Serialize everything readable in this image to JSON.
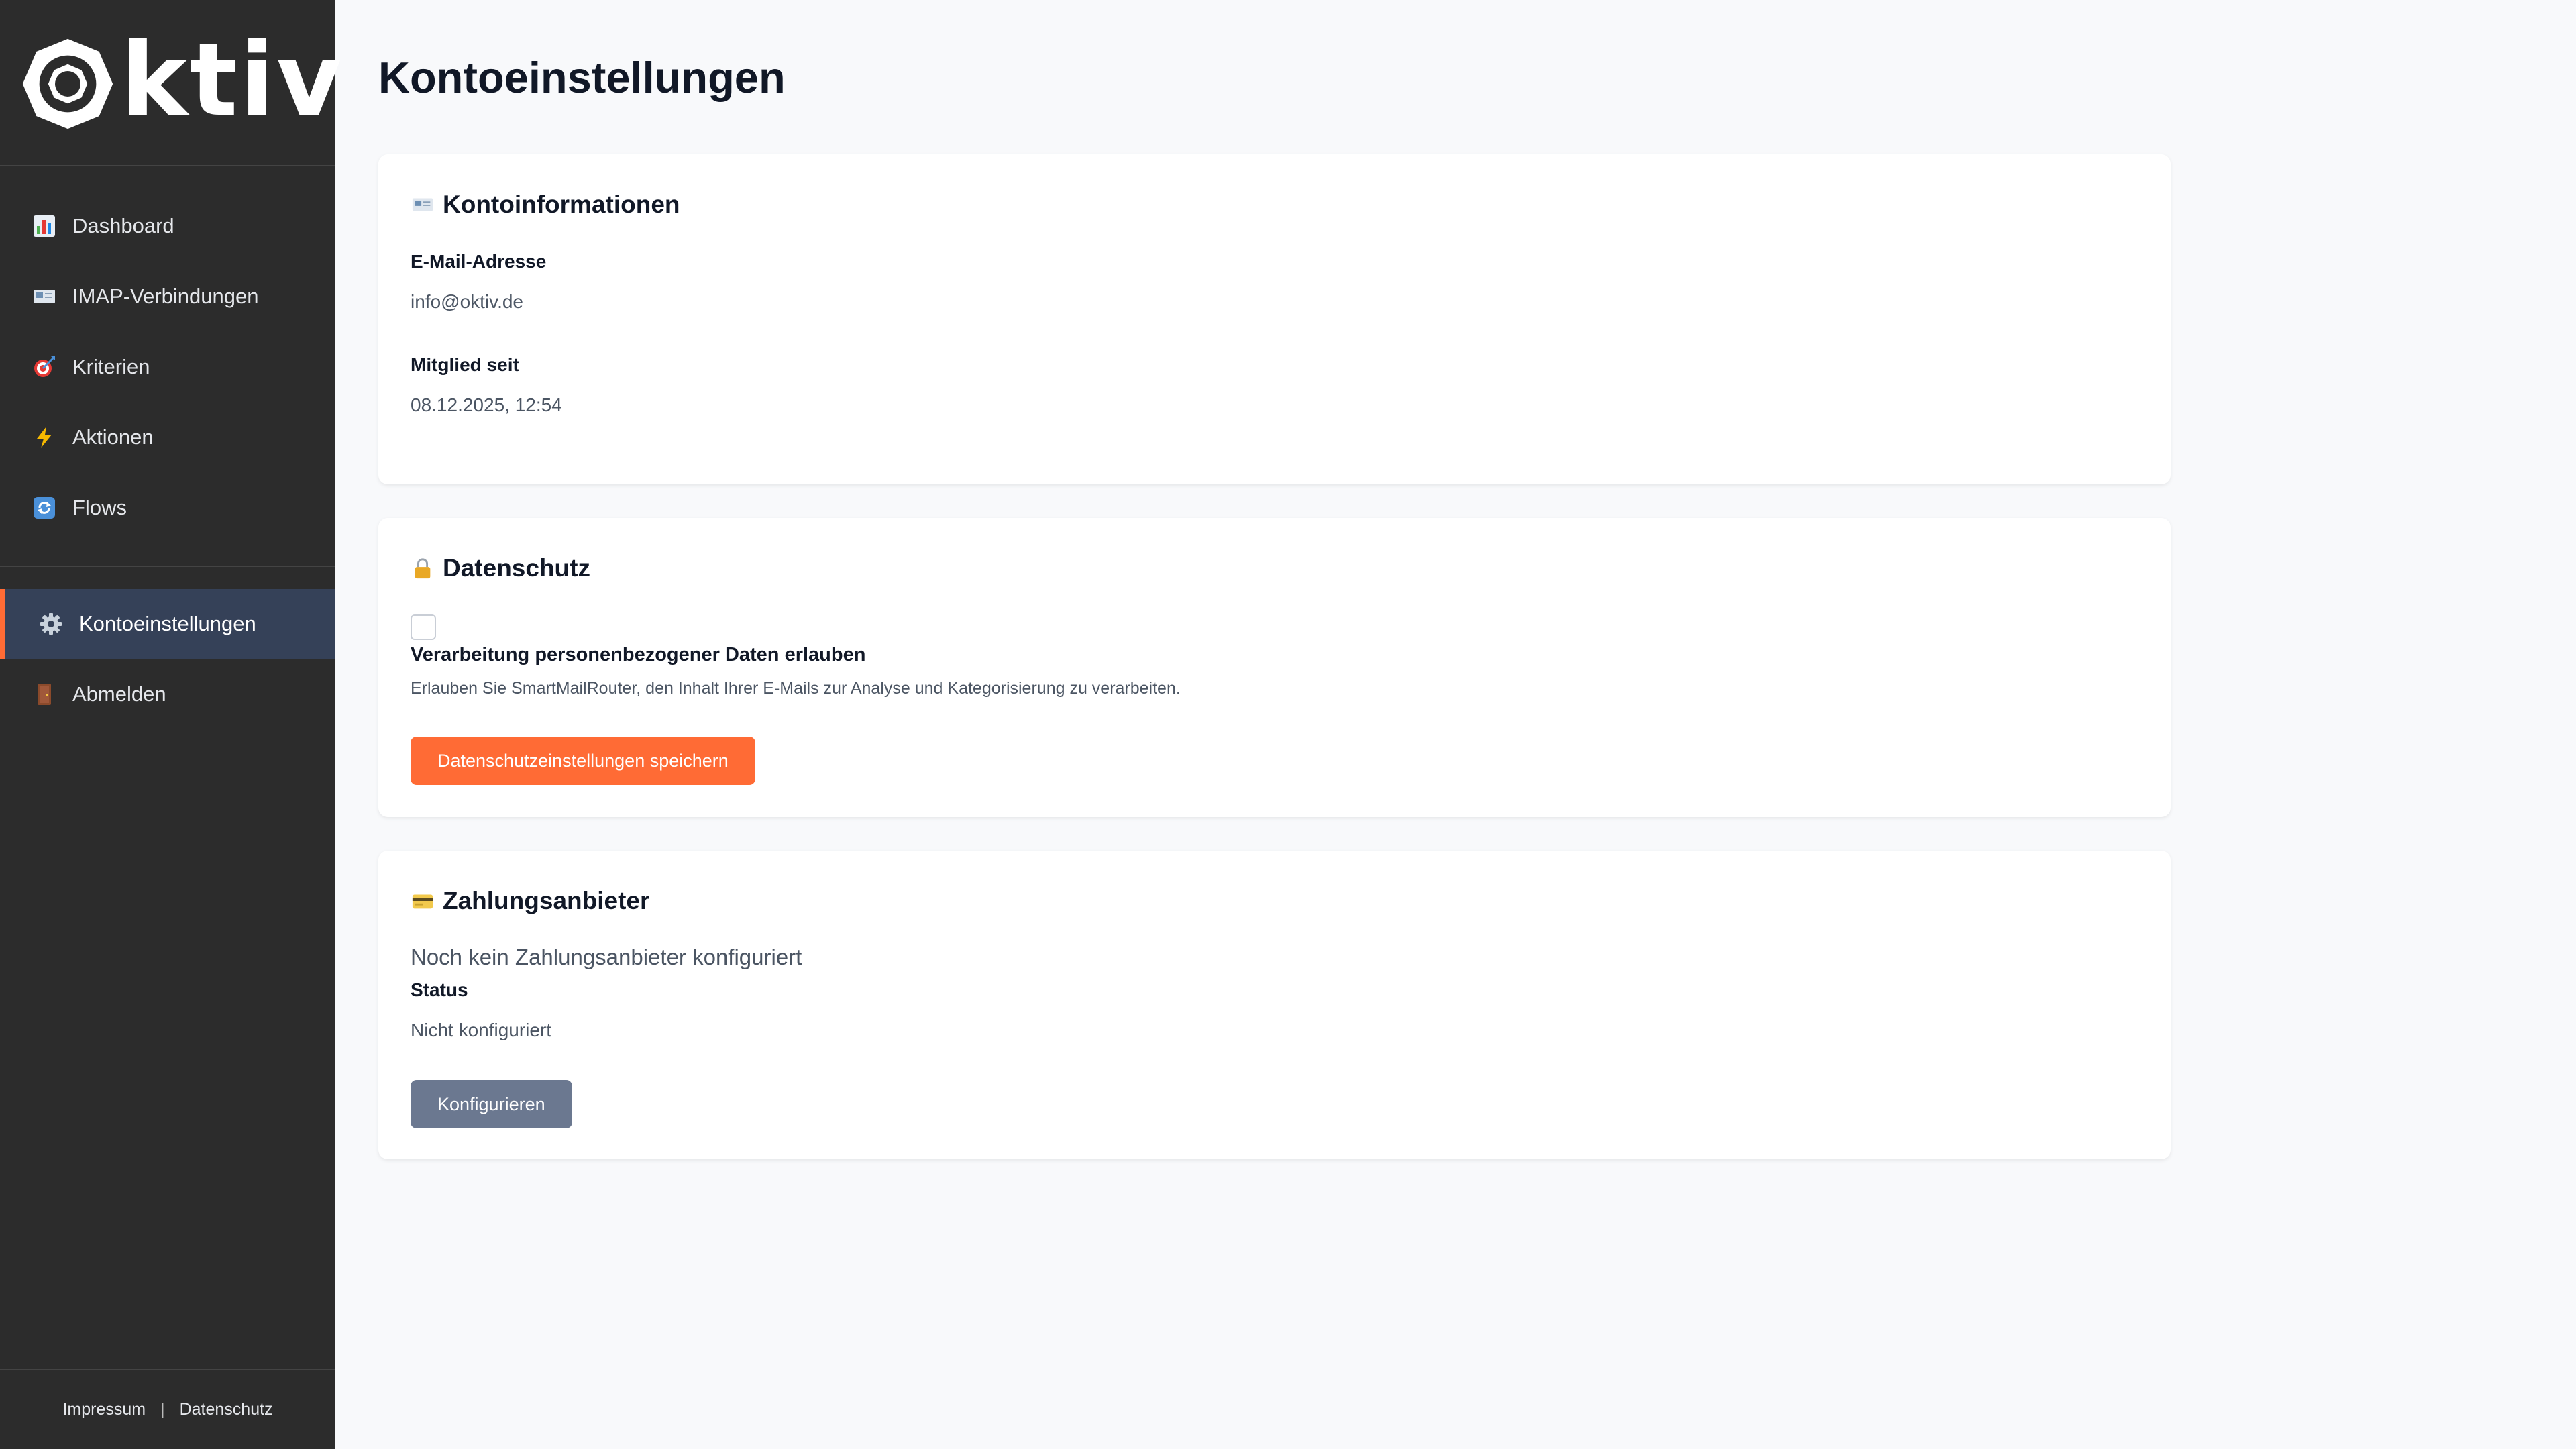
{
  "brand": {
    "logo_text": "ktiv"
  },
  "sidebar": {
    "items": [
      {
        "label": "Dashboard",
        "icon": "bar-chart-icon"
      },
      {
        "label": "IMAP-Verbindungen",
        "icon": "email-icon"
      },
      {
        "label": "Kriterien",
        "icon": "target-icon"
      },
      {
        "label": "Aktionen",
        "icon": "lightning-icon"
      },
      {
        "label": "Flows",
        "icon": "refresh-icon"
      }
    ],
    "secondary_items": [
      {
        "label": "Kontoeinstellungen",
        "icon": "gear-icon",
        "active": true
      },
      {
        "label": "Abmelden",
        "icon": "door-icon"
      }
    ],
    "footer": {
      "impressum": "Impressum",
      "separator": "|",
      "datenschutz": "Datenschutz"
    }
  },
  "page": {
    "title": "Kontoeinstellungen"
  },
  "account_info": {
    "title": "Kontoinformationen",
    "icon": "email-icon",
    "email_label": "E-Mail-Adresse",
    "email_value": "info@oktiv.de",
    "member_label": "Mitglied seit",
    "member_value": "08.12.2025, 12:54"
  },
  "privacy": {
    "title": "Datenschutz",
    "icon": "lock-icon",
    "checkbox_checked": false,
    "checkbox_label": "Verarbeitung personenbezogener Daten erlauben",
    "help_text": "Erlauben Sie SmartMailRouter, den Inhalt Ihrer E-Mails zur Analyse und Kategorisierung zu verarbeiten.",
    "save_button": "Datenschutzeinstellungen speichern"
  },
  "payment": {
    "title": "Zahlungsanbieter",
    "icon": "credit-card-icon",
    "notice": "Noch kein Zahlungsanbieter konfiguriert",
    "status_label": "Status",
    "status_value": "Nicht konfiguriert",
    "configure_button": "Konfigurieren"
  },
  "colors": {
    "sidebar_bg": "#2c2c2c",
    "active_item_bg": "#354158",
    "accent": "#ff6b35",
    "secondary_button": "#6b7890",
    "page_bg": "#f8f9fb"
  }
}
